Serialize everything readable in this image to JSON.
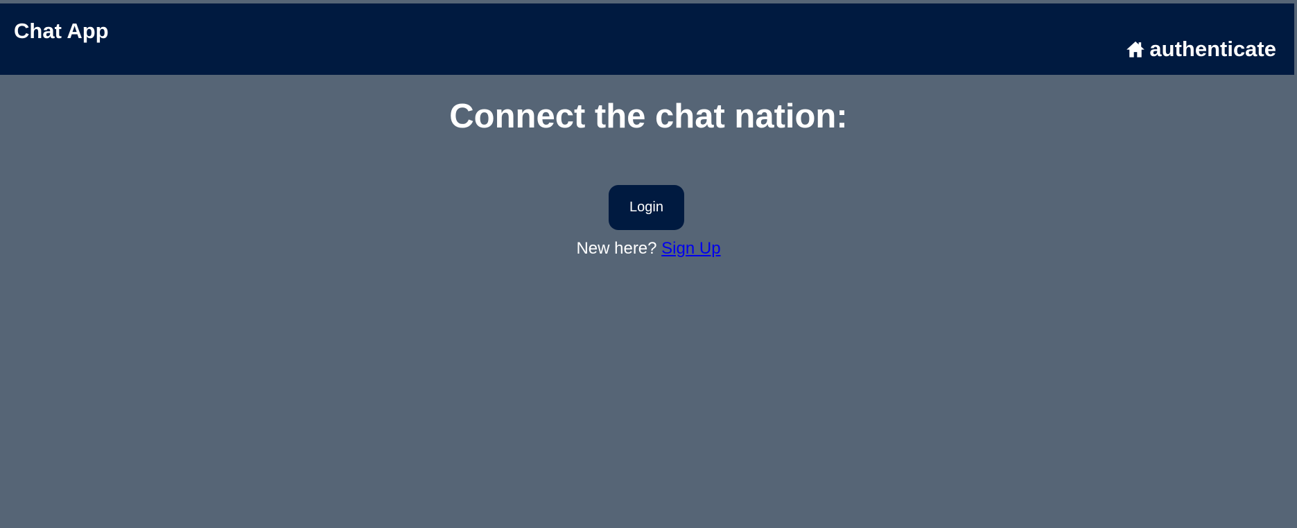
{
  "navbar": {
    "brand": "Chat App",
    "right_link": {
      "icon": "home-icon",
      "label": "authenticate"
    }
  },
  "main": {
    "heading": "Connect the chat nation:",
    "login_label": "Login",
    "signup_prompt": "New here?",
    "signup_link": "Sign Up"
  },
  "colors": {
    "background": "#566576",
    "navbar": "#001a40",
    "button": "#001a40",
    "text": "#ffffff",
    "link": "#0000ee"
  }
}
